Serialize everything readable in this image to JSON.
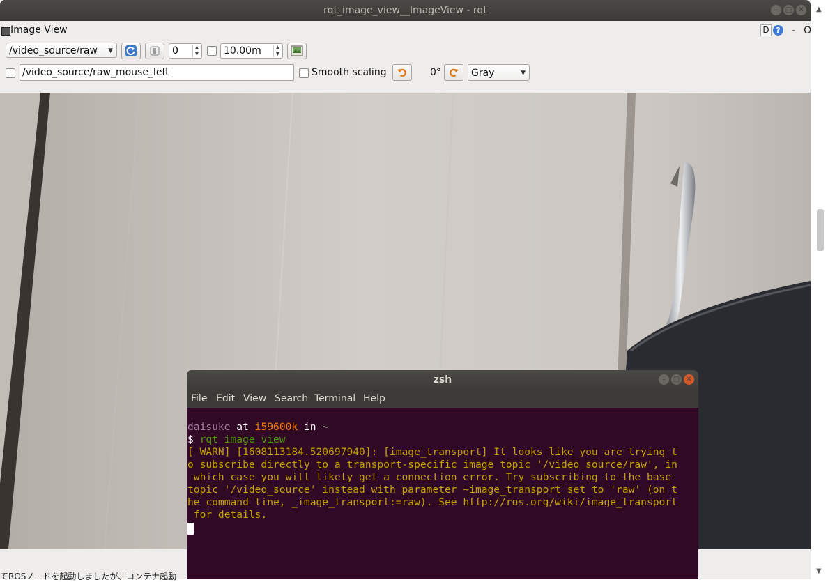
{
  "rqt": {
    "window_title": "rqt_image_view__ImageView - rqt",
    "panel_title": "Image View",
    "panel_d_button": "D",
    "panel_help_button": "?",
    "panel_minimize": "-",
    "panel_close": "O",
    "topic_combo": "/video_source/raw",
    "spin_value": "0",
    "duration_value": "10.00m",
    "mouse_topic": "/video_source/raw_mouse_left",
    "smooth_scaling_label": "Smooth scaling",
    "rotation_label": "0°",
    "color_scheme": "Gray",
    "bottom_status_text": "てROSノードを起動しましたが、コンテナ起動"
  },
  "terminal": {
    "title": "zsh",
    "menu": [
      "File",
      "Edit",
      "View",
      "Search",
      "Terminal",
      "Help"
    ],
    "prompt_user": "daisuke",
    "prompt_at": " at ",
    "prompt_host": "i59600k",
    "prompt_in": " in ",
    "prompt_dir": "~",
    "prompt_symbol": "$ ",
    "command": "rqt_image_view",
    "warn_lines": [
      "[ WARN] [1608113184.520697940]: [image_transport] It looks like you are trying t",
      "o subscribe directly to a transport-specific image topic '/video_source/raw', in",
      " which case you will likely get a connection error. Try subscribing to the base",
      "topic '/video_source' instead with parameter ~image_transport set to 'raw' (on t",
      "he command line, _image_transport:=raw). See http://ros.org/wiki/image_transport",
      " for details."
    ]
  },
  "colors": {
    "terminal_bg": "#300a24",
    "user": "#ad7fa8",
    "host": "#f57900",
    "command": "#4e9a06",
    "warning": "#c4a000"
  }
}
